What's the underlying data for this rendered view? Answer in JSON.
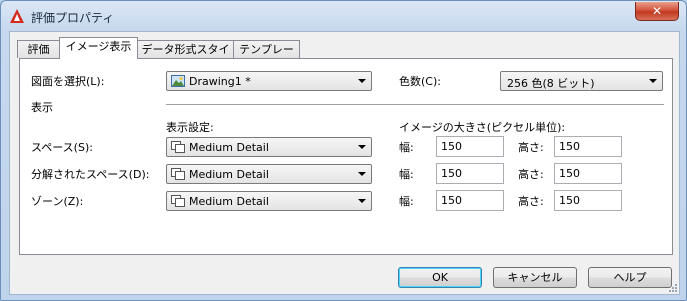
{
  "window": {
    "title": "評価プロパティ",
    "close_glyph": "✕"
  },
  "tabs": [
    {
      "label": "評価"
    },
    {
      "label": "イメージ表示"
    },
    {
      "label": "データ形式スタイル"
    },
    {
      "label": "テンプレート"
    }
  ],
  "drawing": {
    "label": "図面を選択(L):",
    "value": "Drawing1 *"
  },
  "colors": {
    "label": "色数(C):",
    "value": "256 色(8 ビット)"
  },
  "display": {
    "section_label": "表示",
    "settings_header": "表示設定:",
    "size_header": "イメージの大きさ(ピクセル単位):",
    "width_label": "幅:",
    "height_label": "高さ:",
    "rows": [
      {
        "label": "スペース(S):",
        "setting": "Medium Detail",
        "width": "150",
        "height": "150"
      },
      {
        "label": "分解されたスペース(D):",
        "setting": "Medium Detail",
        "width": "150",
        "height": "150"
      },
      {
        "label": "ゾーン(Z):",
        "setting": "Medium Detail",
        "width": "150",
        "height": "150"
      }
    ]
  },
  "buttons": {
    "ok": "OK",
    "cancel": "キャンセル",
    "help": "ヘルプ"
  }
}
